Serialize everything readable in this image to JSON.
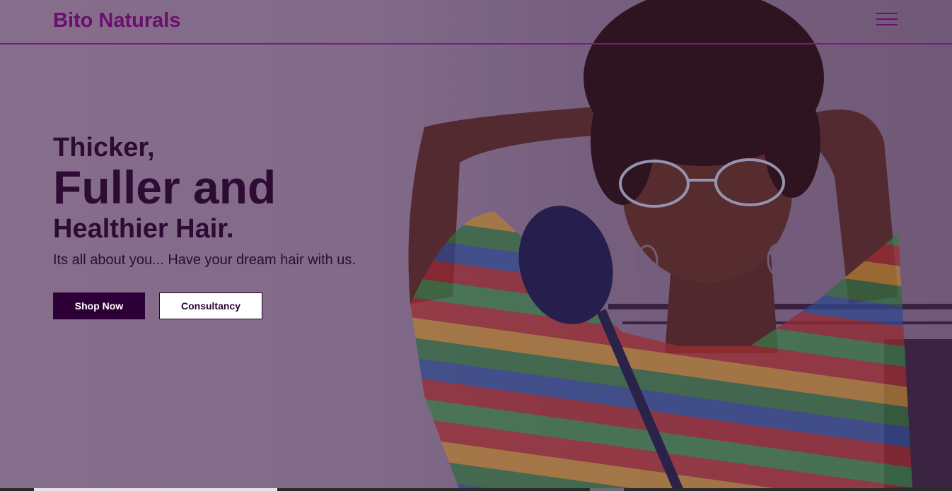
{
  "brand": {
    "name": "Bito Naturals",
    "color": "#6b0f6e"
  },
  "nav": {
    "menu_icon": "hamburger-menu-icon"
  },
  "hero": {
    "headline_line1": "Thicker,",
    "headline_line2": "Fuller and",
    "headline_line3": "Healthier Hair.",
    "tagline": "Its all about you... Have your dream hair with us.",
    "text_color": "#2d0b34"
  },
  "buttons": {
    "primary_label": "Shop Now",
    "secondary_label": "Consultancy",
    "primary_bg": "#2d0038"
  }
}
